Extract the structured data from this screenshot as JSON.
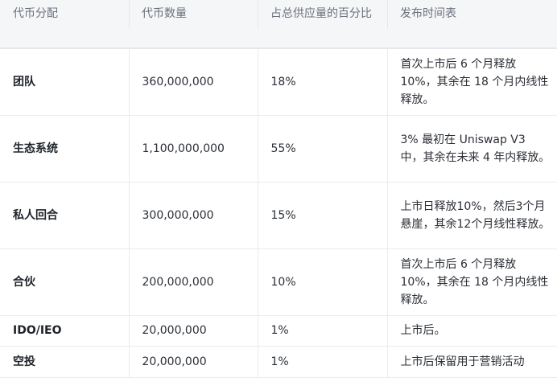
{
  "table": {
    "headers": [
      "代币分配",
      "代币数量",
      "占总供应量的百分比",
      "发布时间表"
    ],
    "rows": [
      {
        "name": "团队",
        "amount": "360,000,000",
        "percent": "18%",
        "schedule": "首次上市后 6 个月释放 10%，其余在 18 个月内线性释放。"
      },
      {
        "name": "生态系统",
        "amount": "1,100,000,000",
        "percent": "55%",
        "schedule": "3% 最初在 Uniswap V3 中，其余在未来 4 年内释放。"
      },
      {
        "name": "私人回合",
        "amount": "300,000,000",
        "percent": "15%",
        "schedule": "上市日释放10%，然后3个月悬崖，其余12个月线性释放。"
      },
      {
        "name": "合伙",
        "amount": "200,000,000",
        "percent": "10%",
        "schedule": "首次上市后 6 个月释放 10%，其余在 18 个月内线性释放。"
      },
      {
        "name": "IDO/IEO",
        "amount": "20,000,000",
        "percent": "1%",
        "schedule": "上市后。"
      },
      {
        "name": "空投",
        "amount": "20,000,000",
        "percent": "1%",
        "schedule": "上市后保留用于营销活动"
      }
    ]
  }
}
